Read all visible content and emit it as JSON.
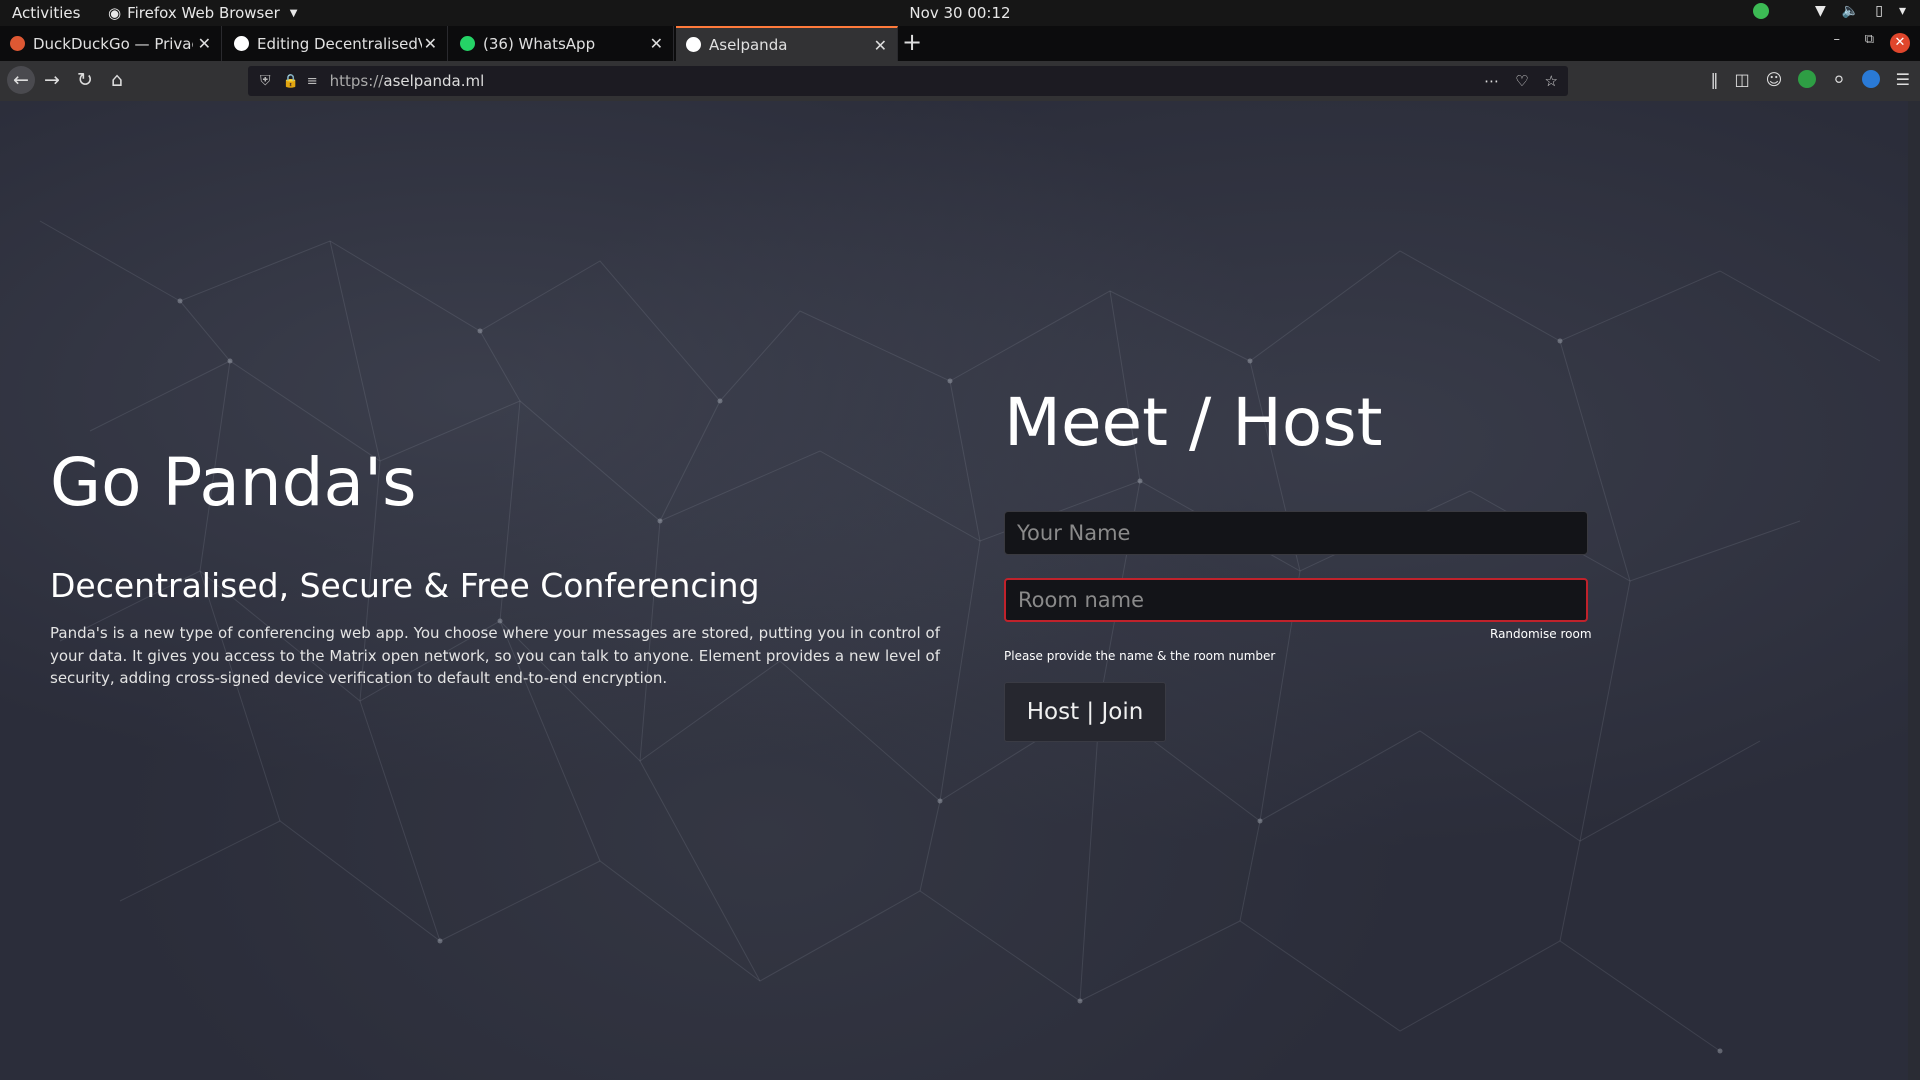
{
  "system": {
    "activities": "Activities",
    "app_name": "Firefox Web Browser",
    "clock": "Nov 30  00:12"
  },
  "tabs": [
    {
      "title": "DuckDuckGo — Privacy, simplified.",
      "favicon_color": "#de5833"
    },
    {
      "title": "Editing DecentralisedVideo",
      "favicon_color": "#ffffff"
    },
    {
      "title": "(36) WhatsApp",
      "favicon_color": "#25d366"
    },
    {
      "title": "Aselpanda",
      "favicon_color": "#ffffff",
      "active": true
    }
  ],
  "navbar": {
    "url_protocol": "https://",
    "url_host": "aselpanda.ml"
  },
  "page": {
    "hero_title": "Go Panda's",
    "hero_subtitle": "Decentralised, Secure & Free Conferencing",
    "hero_description": "Panda's is a new type of conferencing web app. You choose where your messages are stored, putting you in control of your data. It gives you access to the Matrix open network, so you can talk to anyone. Element provides a new level of security, adding cross-signed device verification to default end-to-end encryption.",
    "form_title": "Meet / Host",
    "name_placeholder": "Your Name",
    "room_placeholder": "Room name",
    "randomise_label": "Randomise room",
    "hint": "Please provide the name & the room number",
    "submit_label": "Host | Join"
  },
  "colors": {
    "accent_tab": "#ff7a3b",
    "error_border": "#c0222b",
    "background": "#2b2d3a"
  }
}
